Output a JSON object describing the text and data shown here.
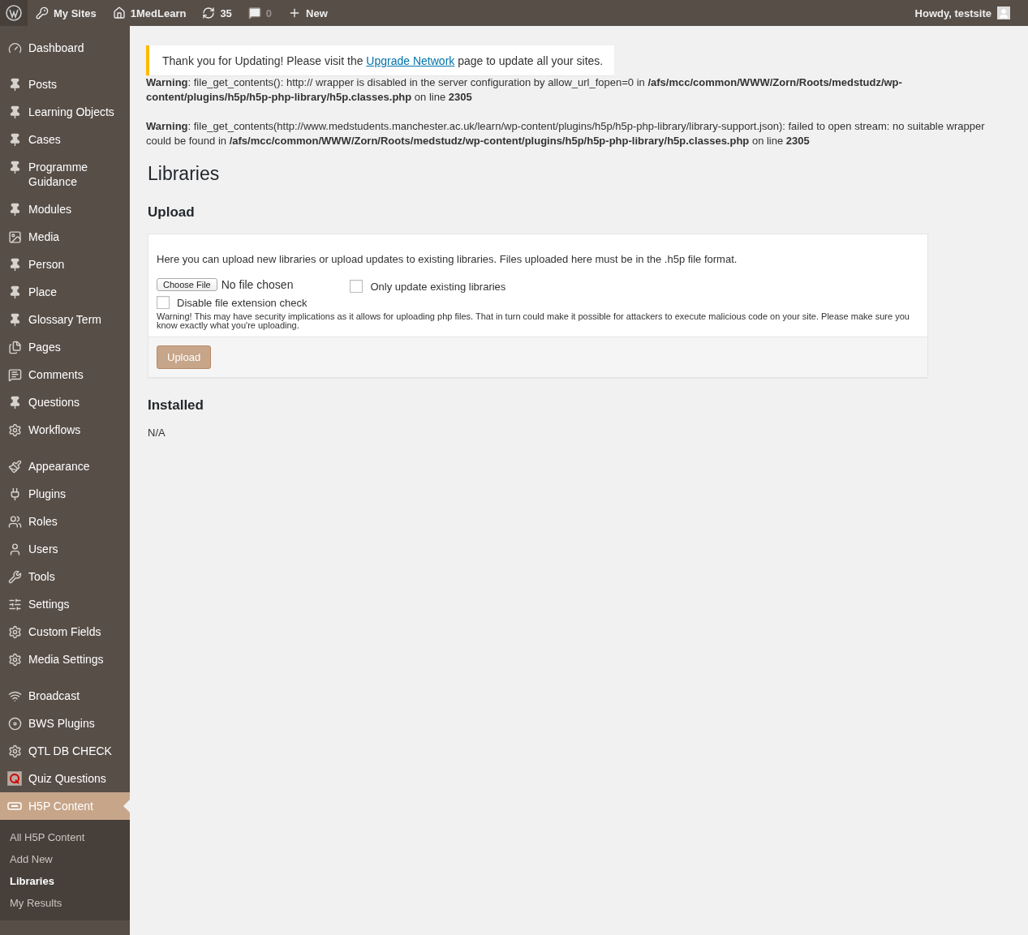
{
  "admin_bar": {
    "items": [
      {
        "kind": "logo"
      },
      {
        "kind": "sites",
        "label": "My Sites"
      },
      {
        "kind": "home",
        "label": "1MedLearn"
      },
      {
        "kind": "updates",
        "label": "35"
      },
      {
        "kind": "comments",
        "label": "0",
        "disabled": true
      },
      {
        "kind": "new",
        "label": "New"
      }
    ],
    "account": {
      "label": "Howdy, testsite"
    }
  },
  "sidebar": {
    "groups": [
      [
        {
          "label": "Dashboard",
          "selected": false
        }
      ],
      [
        {
          "label": "Posts",
          "selected": false
        },
        {
          "label": "Learning Objects",
          "selected": false
        },
        {
          "label": "Cases",
          "selected": false
        },
        {
          "label": "Programme Guidance",
          "selected": false
        },
        {
          "label": "Modules",
          "selected": false
        },
        {
          "label": "Media",
          "selected": false
        },
        {
          "label": "Person",
          "selected": false
        },
        {
          "label": "Place",
          "selected": false
        },
        {
          "label": "Glossary Term",
          "selected": false
        },
        {
          "label": "Pages",
          "selected": false
        },
        {
          "label": "Comments",
          "selected": false
        },
        {
          "label": "Questions",
          "selected": false
        },
        {
          "label": "Workflows",
          "selected": false
        }
      ],
      [
        {
          "label": "Appearance",
          "selected": false
        },
        {
          "label": "Plugins",
          "selected": false
        },
        {
          "label": "Roles",
          "selected": false
        },
        {
          "label": "Users",
          "selected": false
        },
        {
          "label": "Tools",
          "selected": false
        },
        {
          "label": "Settings",
          "selected": false
        },
        {
          "label": "Custom Fields",
          "selected": false
        },
        {
          "label": "Media Settings",
          "selected": false
        }
      ],
      [
        {
          "label": "Broadcast",
          "selected": false
        },
        {
          "label": "BWS Plugins",
          "selected": false
        },
        {
          "label": "QTL DB CHECK",
          "selected": false
        },
        {
          "label": "Quiz Questions",
          "selected": false
        },
        {
          "label": "H5P Content",
          "selected": true,
          "children": [
            {
              "label": "All H5P Content",
              "selected": false
            },
            {
              "label": "Add New",
              "selected": false
            },
            {
              "label": "Libraries",
              "selected": true
            },
            {
              "label": "My Results",
              "selected": false
            }
          ]
        }
      ]
    ]
  },
  "notice": {
    "text_before": "Thank you for Updating! Please visit the",
    "link": "Upgrade Network",
    "text_after": "page to update all your sites."
  },
  "warnings": [
    "**Warning**: file_get_contents(): http:// wrapper is disabled in the server configuration by allow_url_fopen=0 in **/afs/mcc/common/WWW/Zorn/Roots/medstudz/wp-content/plugins/h5p/h5p-php-library/h5p.classes.php** on line **2305**",
    "**Warning**: file_get_contents(http://www.medstudents.manchester.ac.uk/learn/wp-content/plugins/h5p/h5p-php-library/library-support.json): failed to open stream: no suitable wrapper could be found in **/afs/mcc/common/WWW/Zorn/Roots/medstudz/wp-content/plugins/h5p/h5p-php-library/h5p.classes.php** on line **2305**"
  ],
  "page_title": "Libraries",
  "upload": {
    "heading": "Upload",
    "intro": "Here you can upload new libraries or upload updates to existing libraries. Files uploaded here must be in the .h5p file format.",
    "file_button": "Choose File",
    "file_status": "No file chosen",
    "options": [
      {
        "label": "Only update existing libraries",
        "checked": false
      },
      {
        "label": "Disable file extension check",
        "checked": false
      }
    ],
    "warning": "Warning! This may have security implications as it allows for uploading php files. That in turn could make it possible for attackers to execute malicious code on your site. Please make sure you know exactly what you're uploading.",
    "submit": "Upload"
  },
  "installed": {
    "heading": "Installed",
    "value": "N/A"
  }
}
